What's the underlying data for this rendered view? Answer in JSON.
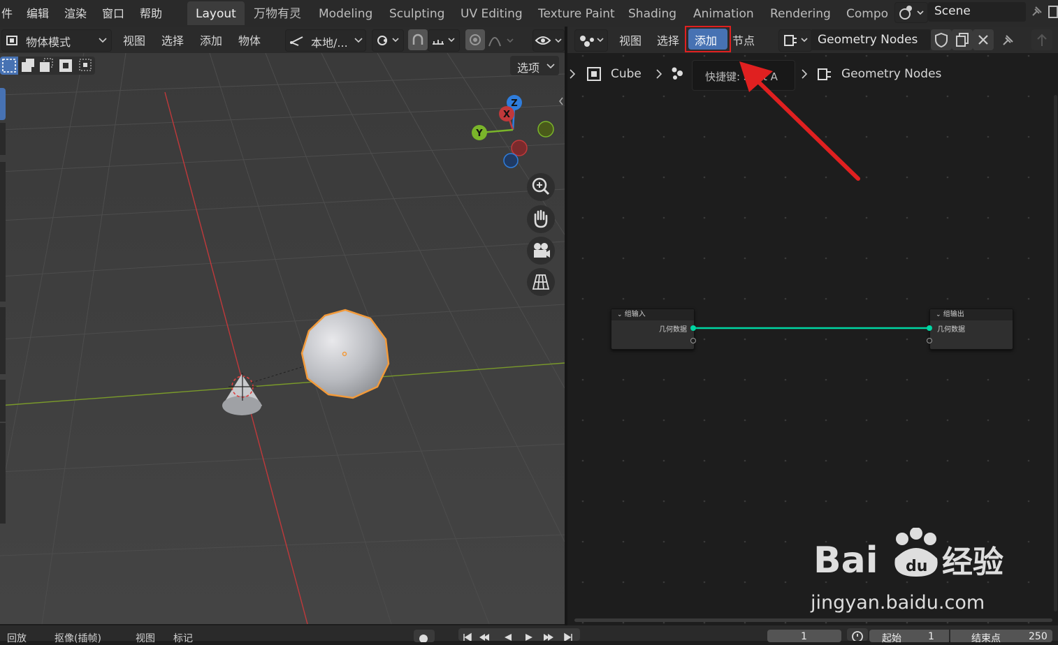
{
  "top_menu": [
    "件",
    "编辑",
    "渲染",
    "窗口",
    "帮助"
  ],
  "workspaces": [
    {
      "label": "Layout",
      "active": true
    },
    {
      "label": "万物有灵"
    },
    {
      "label": "Modeling"
    },
    {
      "label": "Sculpting"
    },
    {
      "label": "UV Editing"
    },
    {
      "label": "Texture Paint"
    },
    {
      "label": "Shading"
    },
    {
      "label": "Animation"
    },
    {
      "label": "Rendering"
    },
    {
      "label": "Compo"
    }
  ],
  "scene_name": "Scene",
  "viewport": {
    "mode": "物体模式",
    "menus": [
      "视图",
      "选择",
      "添加",
      "物体"
    ],
    "transform_orientation": "本地/...",
    "options_label": "选项",
    "gizmo_axes": {
      "z": "Z",
      "x": "X",
      "y": "Y"
    }
  },
  "node_editor": {
    "menus": [
      "视图",
      "选择",
      "添加",
      "节点"
    ],
    "highlighted_menu": "添加",
    "node_tree_name": "Geometry Nodes",
    "breadcrumb": {
      "object": "Cube",
      "tooltip": "快捷键: Shift A",
      "tree": "Geometry Nodes"
    },
    "nodes": {
      "group_input": {
        "title": "组输入",
        "socket": "几何数据"
      },
      "group_output": {
        "title": "组输出",
        "socket": "几何数据"
      }
    }
  },
  "timeline": {
    "labels": [
      "回放",
      "抠像(插帧)",
      "视图",
      "标记"
    ],
    "current_frame": "1",
    "start_label": "起始",
    "start": "1",
    "end_label": "结束点",
    "end": "250"
  },
  "watermark": {
    "brand": "Bai du 经验",
    "url": "jingyan.baidu.com"
  },
  "colors": {
    "highlight_red": "#e02020",
    "active_menu": "#4772b3",
    "node_link": "#00d6a3",
    "selected_outline": "#f29a3a"
  }
}
